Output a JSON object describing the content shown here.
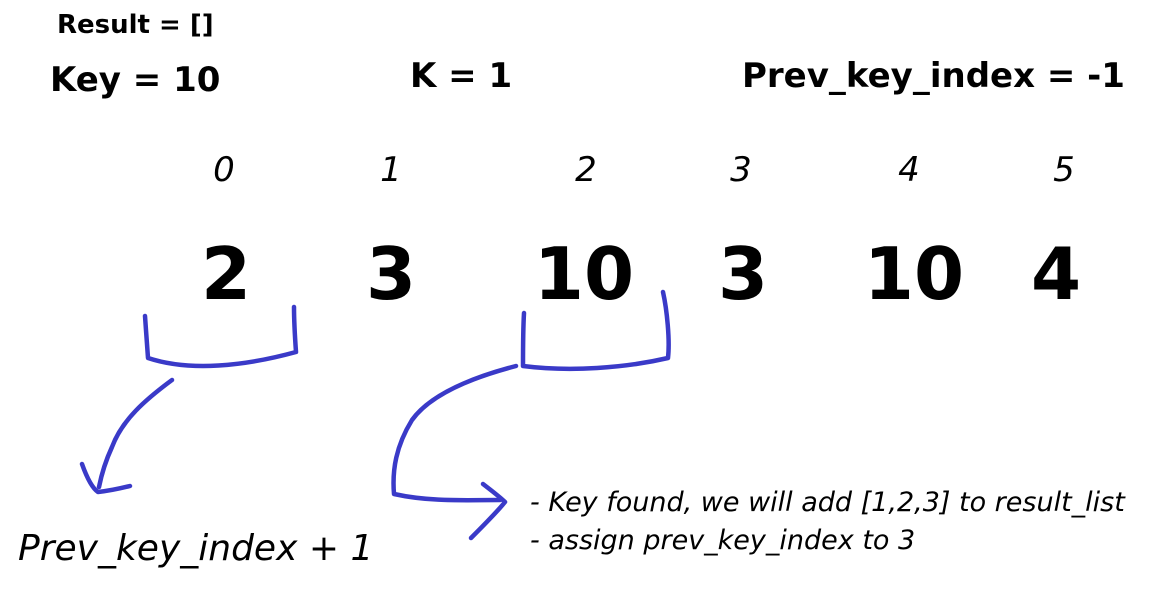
{
  "header": {
    "result": "Result = []",
    "key": "Key = 10",
    "k": "K = 1",
    "prev_key_index": "Prev_key_index = -1"
  },
  "array": {
    "indices": [
      "0",
      "1",
      "2",
      "3",
      "4",
      "5"
    ],
    "values": [
      "2",
      "3",
      "10",
      "3",
      "10",
      "4"
    ]
  },
  "annotations": {
    "formula": "Prev_key_index + 1",
    "note_1": "- Key found, we will add [1,2,3] to result_list",
    "note_2": "- assign prev_key_index to 3"
  },
  "colors": {
    "marker_stroke": "#3a3ac8",
    "text": "#000000"
  }
}
